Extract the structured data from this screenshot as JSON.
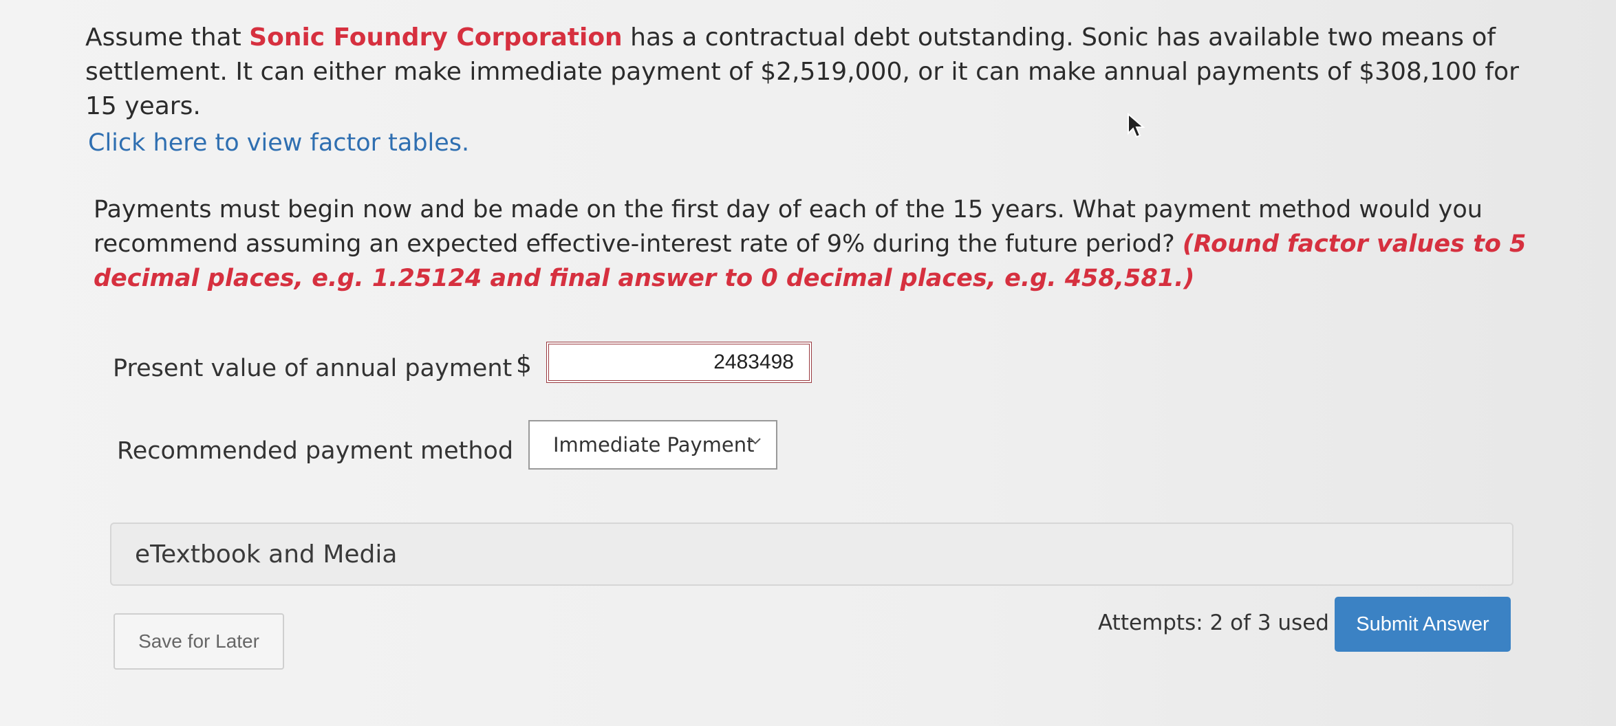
{
  "problem": {
    "intro": "Assume that ",
    "company": "Sonic Foundry Corporation",
    "text": " has a contractual debt outstanding. Sonic has available two means of settlement. It can either make immediate payment of $2,519,000, or it can make annual payments of $308,100 for 15 years."
  },
  "factor_link": "Click here to view factor tables.",
  "question": {
    "text": "Payments must begin now and be made on the first day of each of the 15 years. What payment method would you recommend assuming an expected effective-interest rate of 9% during the future period? ",
    "instruction": "(Round factor values to 5 decimal places, e.g. 1.25124 and final answer to 0 decimal places, e.g. 458,581.)"
  },
  "present_value": {
    "label": "Present value of annual payment",
    "currency": "$",
    "value": "2483498"
  },
  "method": {
    "label": "Recommended payment method",
    "selected": "Immediate Payment"
  },
  "etextbook": "eTextbook and Media",
  "save_button": "Save for Later",
  "attempts": "Attempts: 2 of 3 used",
  "submit_button": "Submit Answer",
  "colors": {
    "accent_red": "#d6303f",
    "link_blue": "#2f6fb1",
    "submit_blue": "#3b82c4"
  },
  "icons": [
    "chevron-down-icon",
    "mouse-cursor-icon"
  ]
}
